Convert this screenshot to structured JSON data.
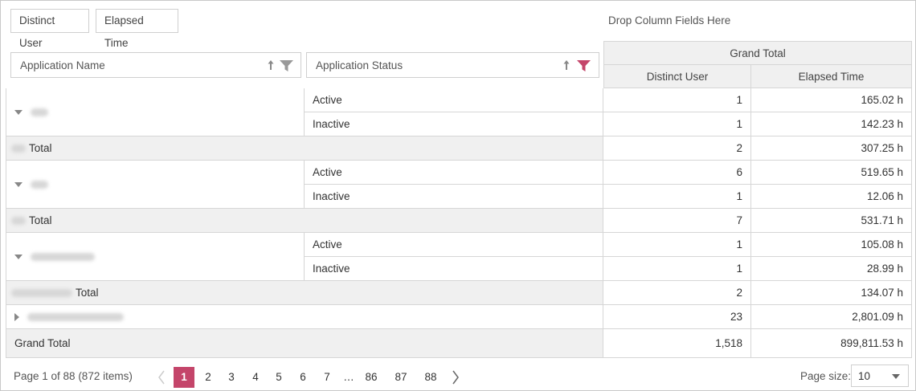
{
  "data_fields": [
    "Distinct User",
    "Elapsed Time"
  ],
  "drop_column_text": "Drop Column Fields Here",
  "row_fields": [
    {
      "label": "Application Name",
      "filter_active": false
    },
    {
      "label": "Application Status",
      "filter_active": true
    }
  ],
  "column_header": {
    "grand_total": "Grand Total",
    "measures": [
      "Distinct User",
      "Elapsed Time"
    ]
  },
  "groups": [
    {
      "rows": [
        {
          "status": "Active",
          "distinct_user": "1",
          "elapsed_time": "165.02 h"
        },
        {
          "status": "Inactive",
          "distinct_user": "1",
          "elapsed_time": "142.23 h"
        }
      ],
      "total_label": "Total",
      "total": {
        "distinct_user": "2",
        "elapsed_time": "307.25 h"
      }
    },
    {
      "rows": [
        {
          "status": "Active",
          "distinct_user": "6",
          "elapsed_time": "519.65 h"
        },
        {
          "status": "Inactive",
          "distinct_user": "1",
          "elapsed_time": "12.06 h"
        }
      ],
      "total_label": "Total",
      "total": {
        "distinct_user": "7",
        "elapsed_time": "531.71 h"
      }
    },
    {
      "rows": [
        {
          "status": "Active",
          "distinct_user": "1",
          "elapsed_time": "105.08 h"
        },
        {
          "status": "Inactive",
          "distinct_user": "1",
          "elapsed_time": "28.99 h"
        }
      ],
      "total_label": "Total",
      "total": {
        "distinct_user": "2",
        "elapsed_time": "134.07 h"
      }
    }
  ],
  "collapsed_row": {
    "distinct_user": "23",
    "elapsed_time": "2,801.09 h"
  },
  "grand_total": {
    "label": "Grand Total",
    "distinct_user": "1,518",
    "elapsed_time": "899,811.53 h"
  },
  "pager": {
    "info": "Page 1 of 88 (872 items)",
    "pages": [
      "1",
      "2",
      "3",
      "4",
      "5",
      "6",
      "7",
      "…",
      "86",
      "87",
      "88"
    ],
    "current": "1",
    "page_size_label": "Page size:",
    "page_size": "10"
  },
  "colors": {
    "accent": "#c4456a",
    "filter_inactive": "#999999"
  }
}
